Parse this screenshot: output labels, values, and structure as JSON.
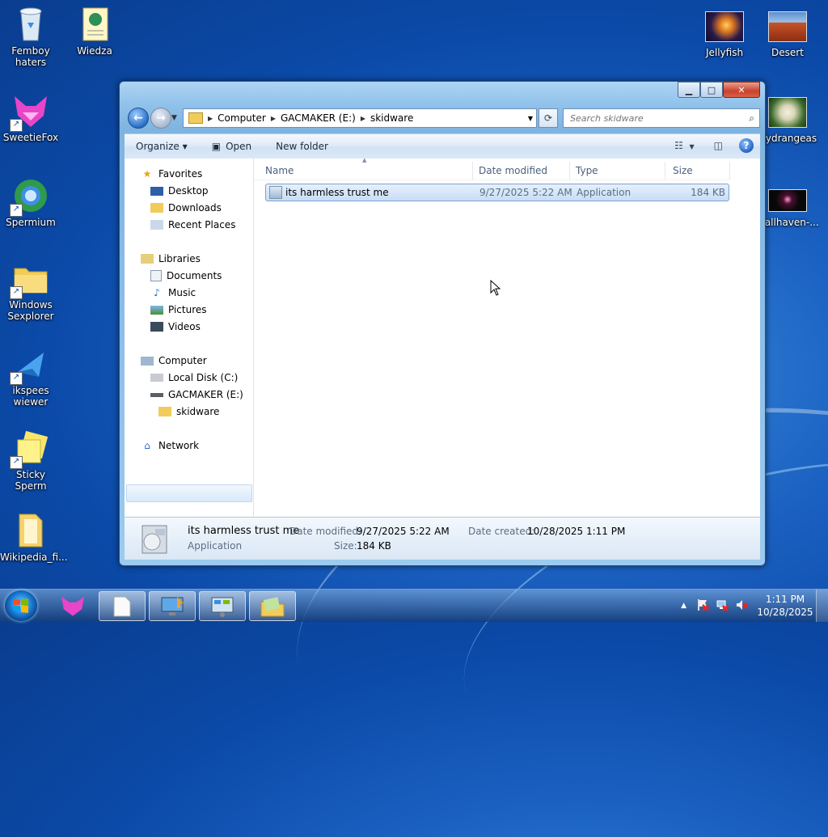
{
  "desktop": {
    "icons_left": [
      {
        "label": "Femboy haters",
        "icon": "recycle-bin-icon"
      },
      {
        "label": "SweetieFox",
        "icon": "sweetiefox-icon"
      },
      {
        "label": "Spermium",
        "icon": "spermium-icon"
      },
      {
        "label": "Windows Sexplorer",
        "icon": "folder-icon"
      },
      {
        "label": "ikspees wiewer",
        "icon": "xps-viewer-icon"
      },
      {
        "label": "Sticky Sperm",
        "icon": "sticky-notes-icon"
      },
      {
        "label": "Wikipedia_fi...",
        "icon": "folder-icon"
      }
    ],
    "icon_wiedza": "Wiedza",
    "icons_right": [
      {
        "label": "Jellyfish"
      },
      {
        "label": "Desert"
      },
      {
        "label": "Hydrangeas"
      },
      {
        "label": "wallhaven-..."
      }
    ]
  },
  "window": {
    "address": [
      "Computer",
      "GACMAKER (E:)",
      "skidware"
    ],
    "search_placeholder": "Search skidware",
    "toolbar": {
      "organize": "Organize",
      "open": "Open",
      "new_folder": "New folder"
    },
    "nav": {
      "favorites": "Favorites",
      "desktop": "Desktop",
      "downloads": "Downloads",
      "recent": "Recent Places",
      "libraries": "Libraries",
      "documents": "Documents",
      "music": "Music",
      "pictures": "Pictures",
      "videos": "Videos",
      "computer": "Computer",
      "local_disk": "Local Disk (C:)",
      "gacmaker": "GACMAKER (E:)",
      "skidware": "skidware",
      "network": "Network"
    },
    "columns": {
      "name": "Name",
      "date": "Date modified",
      "type": "Type",
      "size": "Size"
    },
    "file": {
      "name": "its harmless trust me",
      "date": "9/27/2025 5:22 AM",
      "type": "Application",
      "size": "184 KB"
    },
    "details": {
      "name": "its harmless trust me",
      "type": "Application",
      "date_modified_label": "Date modified:",
      "date_modified": "9/27/2025 5:22 AM",
      "size_label": "Size:",
      "size": "184 KB",
      "date_created_label": "Date created:",
      "date_created": "10/28/2025 1:11 PM"
    }
  },
  "taskbar": {
    "time": "1:11 PM",
    "date": "10/28/2025"
  },
  "colors": {
    "accent": "#1c62c2",
    "selection": "#c8ddf6"
  }
}
